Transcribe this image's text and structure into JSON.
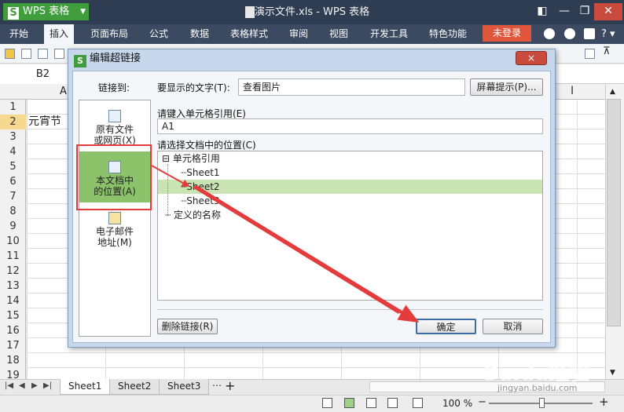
{
  "titlebar": {
    "app_button": "WPS 表格",
    "document_title": "演示文件.xls - WPS 表格"
  },
  "menubar": {
    "items": [
      "开始",
      "插入",
      "页面布局",
      "公式",
      "数据",
      "表格样式",
      "审阅",
      "视图",
      "开发工具",
      "特色功能"
    ],
    "active": "插入",
    "login_label": "未登录",
    "help": "?"
  },
  "formulabar": {
    "namebox": "B2"
  },
  "sheet": {
    "col_a": "A",
    "col_i": "I",
    "cell_a2": "元宵节",
    "rows": [
      "1",
      "2",
      "3",
      "4",
      "5",
      "6",
      "7",
      "8",
      "9",
      "10",
      "11",
      "12",
      "13",
      "14",
      "15",
      "16",
      "17",
      "18",
      "19"
    ],
    "selected_row": "2"
  },
  "tabs": {
    "sheets": [
      "Sheet1",
      "Sheet2",
      "Sheet3"
    ],
    "active": "Sheet1",
    "add": "+"
  },
  "statusbar": {
    "zoom": "100 %"
  },
  "dialog": {
    "title": "编辑超链接",
    "close": "×",
    "link_to_label": "链接到:",
    "display_text_label": "要显示的文字(T):",
    "display_text_value": "查看图片",
    "screentip_button": "屏幕提示(P)...",
    "cell_ref_label": "请键入单元格引用(E)",
    "cell_ref_value": "A1",
    "select_place_label": "请选择文档中的位置(C)",
    "link_types": [
      {
        "label": "原有文件\n或网页(X)"
      },
      {
        "label": "本文档中\n的位置(A)"
      },
      {
        "label": "电子邮件\n地址(M)"
      }
    ],
    "tree": {
      "root": "单元格引用",
      "children": [
        "Sheet1",
        "Sheet2",
        "Sheet3"
      ],
      "selected": "Sheet2",
      "defined_names": "定义的名称"
    },
    "remove_link_button": "删除链接(R)",
    "ok_button": "确定",
    "cancel_button": "取消"
  },
  "watermark": {
    "brand": "Baidu经验",
    "url": "jingyan.baidu.com"
  },
  "colors": {
    "accent_green": "#3f9d3c",
    "selection_green": "#8cc26a",
    "annotation_red": "#e43c3c",
    "titlebar": "#2f3d52"
  }
}
